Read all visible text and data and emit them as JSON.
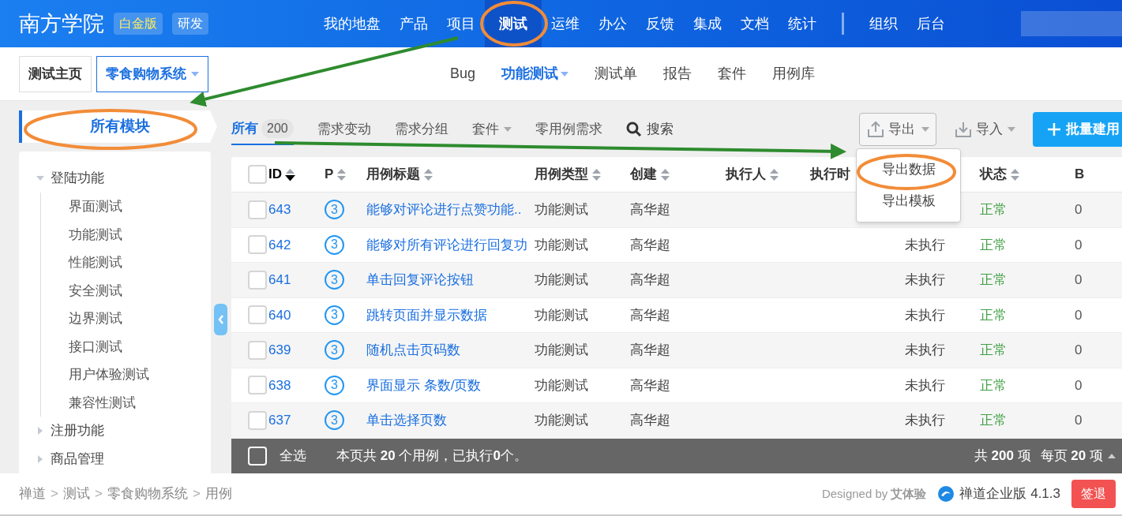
{
  "top_nav": {
    "brand": "南方学院",
    "badges": [
      {
        "label": "白金版",
        "kind": "edition"
      },
      {
        "label": "研发",
        "kind": "group"
      }
    ],
    "items": [
      {
        "label": "我的地盘",
        "selected": false
      },
      {
        "label": "产品",
        "selected": false
      },
      {
        "label": "项目",
        "selected": false
      },
      {
        "label": "测试",
        "selected": true
      },
      {
        "label": "运维",
        "selected": false
      },
      {
        "label": "办公",
        "selected": false
      },
      {
        "label": "反馈",
        "selected": false
      },
      {
        "label": "集成",
        "selected": false
      },
      {
        "label": "文档",
        "selected": false
      },
      {
        "label": "统计",
        "selected": false
      }
    ],
    "admin_items": [
      "组织",
      "后台"
    ]
  },
  "subnav": {
    "breadcrumb": [
      {
        "label": "测试主页",
        "selected": false,
        "dropdown": false
      },
      {
        "label": "零食购物系统",
        "selected": true,
        "dropdown": true
      }
    ],
    "tabs": [
      {
        "label": "Bug",
        "selected": false,
        "dropdown": false
      },
      {
        "label": "功能测试",
        "selected": true,
        "dropdown": true
      },
      {
        "label": "测试单",
        "selected": false,
        "dropdown": false
      },
      {
        "label": "报告",
        "selected": false,
        "dropdown": false
      },
      {
        "label": "套件",
        "selected": false,
        "dropdown": false
      },
      {
        "label": "用例库",
        "selected": false,
        "dropdown": false
      }
    ]
  },
  "sidebar": {
    "title": "所有模块",
    "tree": [
      {
        "label": "登陆功能",
        "expanded": true,
        "children": [
          {
            "label": "界面测试"
          },
          {
            "label": "功能测试"
          },
          {
            "label": "性能测试"
          },
          {
            "label": "安全测试"
          },
          {
            "label": "边界测试"
          },
          {
            "label": "接口测试"
          },
          {
            "label": "用户体验测试"
          },
          {
            "label": "兼容性测试"
          }
        ]
      },
      {
        "label": "注册功能",
        "expanded": false
      },
      {
        "label": "商品管理",
        "expanded": false
      }
    ]
  },
  "filters": [
    {
      "label": "所有",
      "selected": true,
      "count": "200",
      "dropdown": false
    },
    {
      "label": "需求变动",
      "selected": false,
      "dropdown": false
    },
    {
      "label": "需求分组",
      "selected": false,
      "dropdown": false
    },
    {
      "label": "套件",
      "selected": false,
      "dropdown": true
    },
    {
      "label": "零用例需求",
      "selected": false,
      "dropdown": false
    }
  ],
  "search": "搜索",
  "actions": {
    "export": {
      "label": "导出",
      "expanded": true,
      "menu": [
        {
          "label": "导出数据"
        },
        {
          "label": "导出模板"
        }
      ]
    },
    "import": {
      "label": "导入"
    },
    "create": {
      "label": "批量建用"
    }
  },
  "table": {
    "select_all_checked": false,
    "columns": [
      {
        "label": "ID",
        "sortable": true,
        "sorted": true
      },
      {
        "label": "P",
        "sortable": true,
        "sorted": false
      },
      {
        "label": "用例标题",
        "sortable": true,
        "sorted": false
      },
      {
        "label": "用例类型",
        "sortable": true,
        "sorted": false
      },
      {
        "label": "创建",
        "sortable": true,
        "sorted": false
      },
      {
        "label": "执行人",
        "sortable": true,
        "sorted": false
      },
      {
        "label": "执行时"
      },
      {
        "label": "状态",
        "sortable": true,
        "sorted": false
      },
      {
        "label": "B"
      }
    ],
    "rows": [
      {
        "id": "643",
        "priority": "3",
        "title": "能够对评论进行点赞功能..",
        "type": "功能测试",
        "creator": "高华超",
        "status": "正常",
        "bugs": "0",
        "checked": false
      },
      {
        "id": "642",
        "priority": "3",
        "title": "能够对所有评论进行回复功",
        "type": "功能测试",
        "creator": "高华超",
        "result": "未执行",
        "status": "正常",
        "bugs": "0",
        "checked": false
      },
      {
        "id": "641",
        "priority": "3",
        "title": "单击回复评论按钮",
        "type": "功能测试",
        "creator": "高华超",
        "result": "未执行",
        "status": "正常",
        "bugs": "0",
        "checked": false
      },
      {
        "id": "640",
        "priority": "3",
        "title": "跳转页面并显示数据",
        "type": "功能测试",
        "creator": "高华超",
        "result": "未执行",
        "status": "正常",
        "bugs": "0",
        "checked": false
      },
      {
        "id": "639",
        "priority": "3",
        "title": "随机点击页码数",
        "type": "功能测试",
        "creator": "高华超",
        "result": "未执行",
        "status": "正常",
        "bugs": "0",
        "checked": false
      },
      {
        "id": "638",
        "priority": "3",
        "title": "界面显示 条数/页数",
        "type": "功能测试",
        "creator": "高华超",
        "result": "未执行",
        "status": "正常",
        "bugs": "0",
        "checked": false
      },
      {
        "id": "637",
        "priority": "3",
        "title": "单击选择页数",
        "type": "功能测试",
        "creator": "高华超",
        "result": "未执行",
        "status": "正常",
        "bugs": "0",
        "checked": false
      }
    ]
  },
  "table_footer": {
    "select_all": "全选",
    "select_all_checked": false,
    "summary": "本页共 **20** 个用例，已执行**0**个。",
    "total": "共 **200** 项",
    "per_page": "每页 **20** 项"
  },
  "status_bar": {
    "breadcrumb": [
      "禅道",
      "测试",
      "零食购物系统",
      "用例"
    ],
    "separator": ">",
    "designed_by": "Designed by **艾体验**",
    "version": "禅道企业版 4.1.3",
    "logout": "签退"
  }
}
